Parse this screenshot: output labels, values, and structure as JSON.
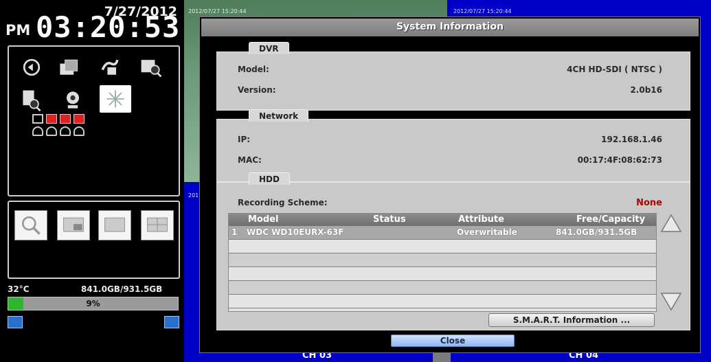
{
  "status": {
    "date": "7/27/2012",
    "ampm": "PM",
    "time": "03:20:53",
    "temperature": "32°C",
    "storage": "841.0GB/931.5GB",
    "usage_percent": 9,
    "usage_label": "9%"
  },
  "cameras": [
    {
      "label": "",
      "timestamp": "2012/07/27 15:20:44"
    },
    {
      "label": "",
      "timestamp": "2012/07/27 15:20:44"
    },
    {
      "label": "CH 03",
      "timestamp": "201"
    },
    {
      "label": "CH 04",
      "timestamp": ""
    }
  ],
  "dialog": {
    "title": "System Information",
    "dvr": {
      "tab": "DVR",
      "model_label": "Model:",
      "model_value": "4CH HD-SDI ( NTSC )",
      "version_label": "Version:",
      "version_value": "2.0b16"
    },
    "network": {
      "tab": "Network",
      "ip_label": "IP:",
      "ip_value": "192.168.1.46",
      "mac_label": "MAC:",
      "mac_value": "00:17:4F:08:62:73"
    },
    "hdd": {
      "tab": "HDD",
      "recording_label": "Recording Scheme:",
      "recording_value": "None",
      "columns": [
        "Model",
        "Status",
        "Attribute",
        "Free/Capacity"
      ],
      "rows": [
        {
          "index": "1",
          "model": "WDC WD10EURX-63F",
          "status": "",
          "attribute": "Overwritable",
          "capacity": "841.0GB/931.5GB"
        }
      ]
    },
    "smart_button": "S.M.A.R.T. Information ...",
    "close_button": "Close"
  },
  "colors": {
    "channel_bg": "#0000c8",
    "progress_fill": "#2fb52f",
    "none_text": "#b00000"
  }
}
